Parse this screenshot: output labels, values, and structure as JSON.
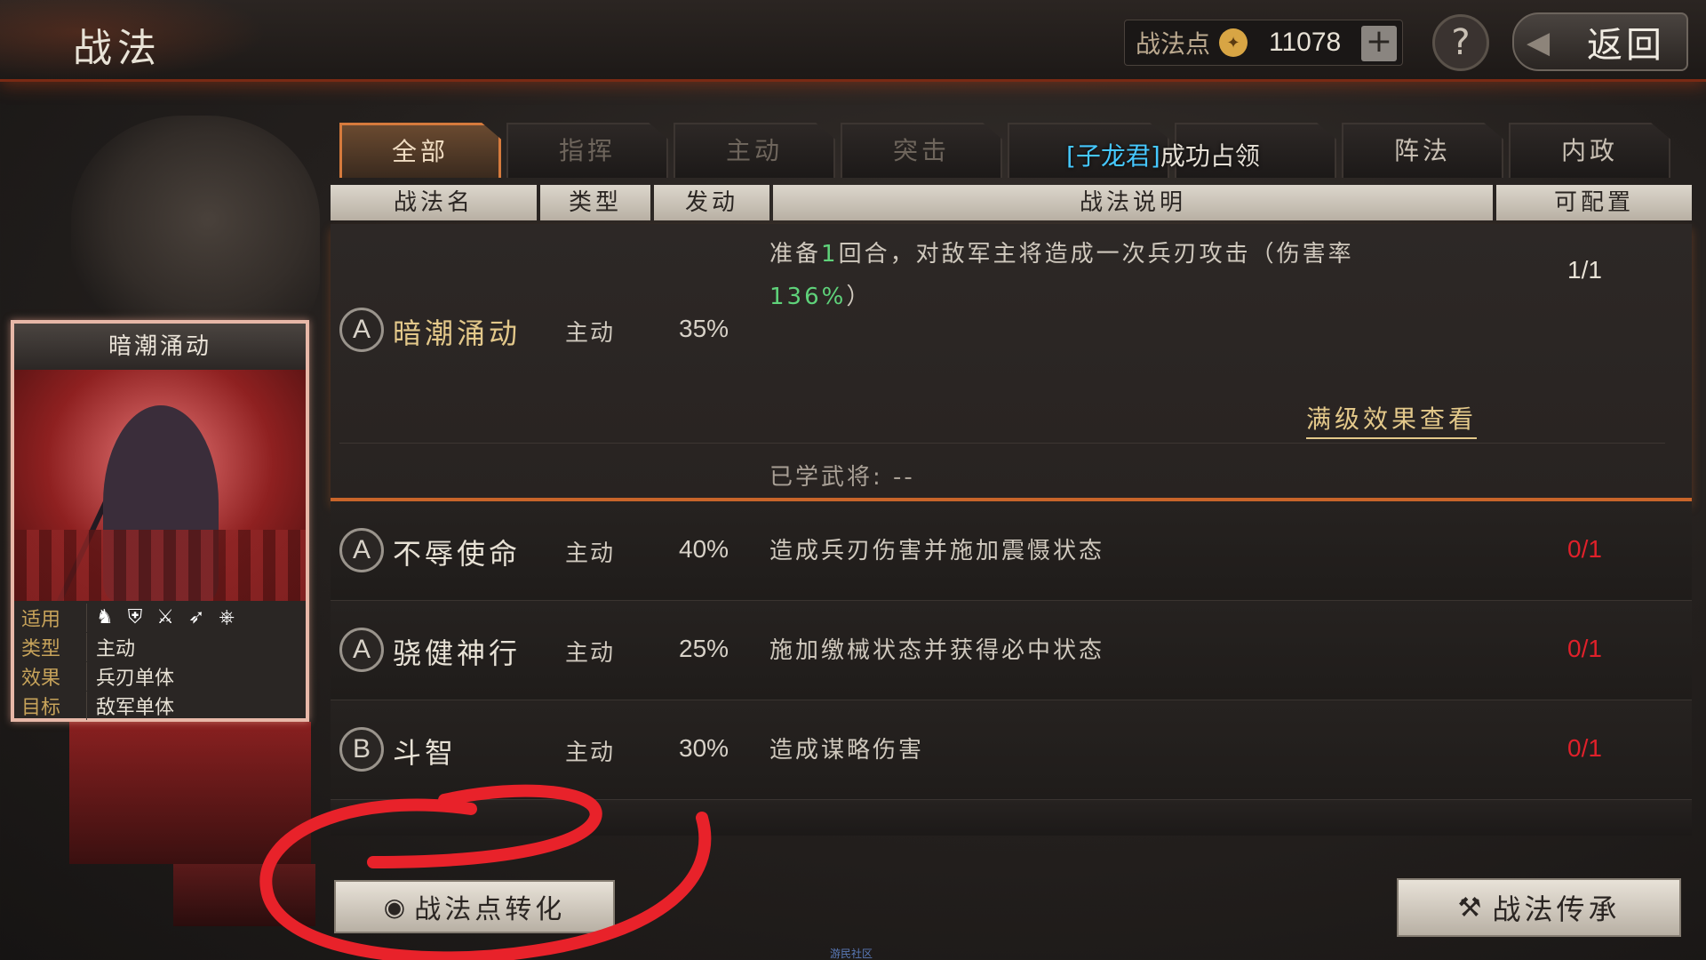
{
  "header": {
    "title": "战法",
    "points_label": "战法点",
    "points_value": "11078",
    "plus_label": "+",
    "help_label": "?",
    "back_label": "返回"
  },
  "tabs": [
    {
      "label": "全部",
      "active": true
    },
    {
      "label": "指挥"
    },
    {
      "label": "主动"
    },
    {
      "label": "突击"
    },
    {
      "label": ""
    },
    {
      "label": ""
    },
    {
      "label": "阵法"
    },
    {
      "label": "内政"
    }
  ],
  "notice": {
    "prefix": "[子龙君]",
    "suffix": "成功占领"
  },
  "columns": [
    "战法名",
    "类型",
    "发动",
    "战法说明",
    "可配置"
  ],
  "card": {
    "title": "暗潮涌动",
    "rows": [
      {
        "key": "适用",
        "value": ""
      },
      {
        "key": "类型",
        "value": "主动"
      },
      {
        "key": "效果",
        "value": "兵刃单体"
      },
      {
        "key": "目标",
        "value": "敌军单体"
      }
    ],
    "unit_icons": [
      "cavalry-icon",
      "shield-icon",
      "crossed-swords-icon",
      "archer-icon",
      "wheel-icon"
    ]
  },
  "expanded": {
    "grade": "A",
    "name": "暗潮涌动",
    "type": "主动",
    "rate": "35%",
    "desc_1a": "准备",
    "desc_1b": "1",
    "desc_1c": "回合，对敌军主将造成一次兵刃攻击（伤害率",
    "desc_2a": "136%",
    "desc_2b": "）",
    "config": "1/1",
    "max_link": "满级效果查看",
    "learned": "已学武将:  --"
  },
  "skills": [
    {
      "grade": "A",
      "name": "不辱使命",
      "type": "主动",
      "rate": "40%",
      "desc": "造成兵刃伤害并施加震慑状态",
      "config": "0/1"
    },
    {
      "grade": "A",
      "name": "骁健神行",
      "type": "主动",
      "rate": "25%",
      "desc": "施加缴械状态并获得必中状态",
      "config": "0/1"
    },
    {
      "grade": "B",
      "name": "斗智",
      "type": "主动",
      "rate": "30%",
      "desc": "造成谋略伤害",
      "config": "0/1"
    }
  ],
  "buttons": {
    "convert": "战法点转化",
    "inherit": "战法传承"
  },
  "watermark": "游民社区",
  "colors": {
    "accent_orange": "#d67a3c",
    "unavailable_red": "#e0202a",
    "highlight_green": "#5fd27a",
    "annotation_red": "#e8222a"
  }
}
